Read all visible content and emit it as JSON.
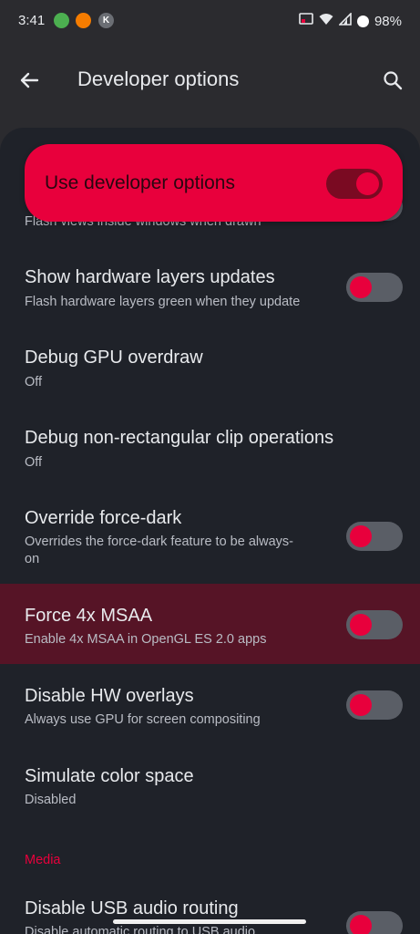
{
  "status_bar": {
    "time": "3:41",
    "notifications": [
      {
        "icon": "whatsapp-icon",
        "color": "#4caf50",
        "glyph": "●"
      },
      {
        "icon": "orange-app-icon",
        "color": "#f57c00",
        "glyph": "●"
      },
      {
        "icon": "k-app-icon",
        "color": "#757575",
        "glyph": "K"
      }
    ],
    "battery": "98%"
  },
  "toolbar": {
    "title": "Developer options",
    "back_icon": "arrow-left-icon",
    "search_icon": "search-icon"
  },
  "master_toggle": {
    "label": "Use developer options",
    "checked": true
  },
  "settings": [
    {
      "id": "show-surface-updates",
      "title": "",
      "subtitle": "Flash views inside windows when drawn",
      "has_switch": true,
      "checked": false,
      "partially_hidden": true
    },
    {
      "id": "show-hardware-layers-updates",
      "title": "Show hardware layers updates",
      "subtitle": "Flash hardware layers green when they update",
      "has_switch": true,
      "checked": false
    },
    {
      "id": "debug-gpu-overdraw",
      "title": "Debug GPU overdraw",
      "subtitle": "Off",
      "has_switch": false
    },
    {
      "id": "debug-non-rect-clip",
      "title": "Debug non-rectangular clip operations",
      "subtitle": "Off",
      "has_switch": false
    },
    {
      "id": "override-force-dark",
      "title": "Override force-dark",
      "subtitle": "Overrides the force-dark feature to be always-on",
      "has_switch": true,
      "checked": false
    },
    {
      "id": "force-4x-msaa",
      "title": "Force 4x MSAA",
      "subtitle": "Enable 4x MSAA in OpenGL ES 2.0 apps",
      "has_switch": true,
      "checked": false,
      "highlighted": true
    },
    {
      "id": "disable-hw-overlays",
      "title": "Disable HW overlays",
      "subtitle": "Always use GPU for screen compositing",
      "has_switch": true,
      "checked": false
    },
    {
      "id": "simulate-color-space",
      "title": "Simulate color space",
      "subtitle": "Disabled",
      "has_switch": false
    }
  ],
  "section": {
    "media_header": "Media"
  },
  "media_settings": [
    {
      "id": "disable-usb-audio-routing",
      "title": "Disable USB audio routing",
      "subtitle": "Disable automatic routing to USB audio",
      "has_switch": true,
      "checked": false
    }
  ],
  "colors": {
    "accent": "#e8003c",
    "background": "#1f2229",
    "highlight": "#561426"
  }
}
